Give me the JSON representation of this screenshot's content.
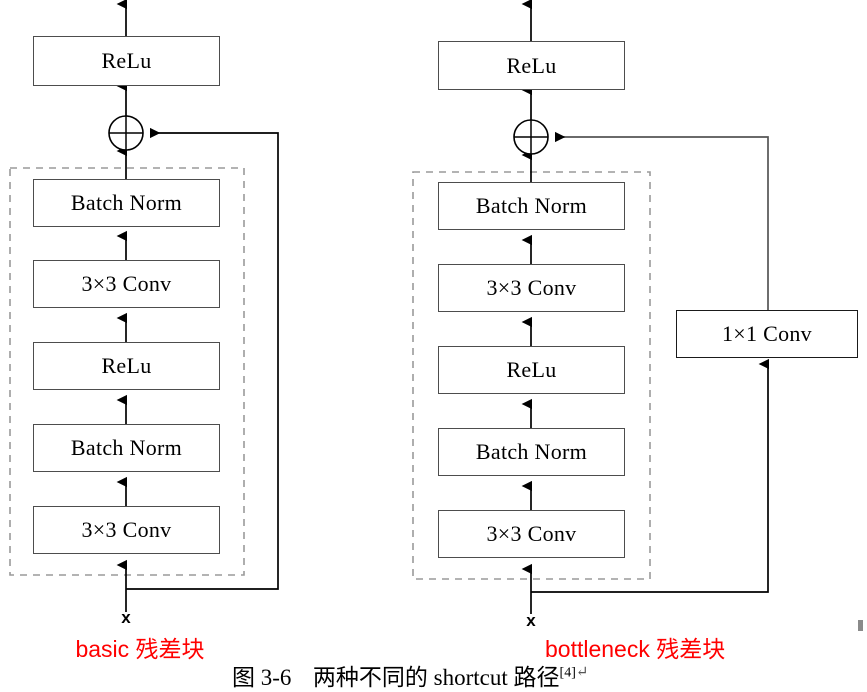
{
  "figure": {
    "caption_prefix": "图 3-6",
    "caption_text": "两种不同的 shortcut 路径",
    "caption_reference": "[4]",
    "caption_mark": "↵",
    "accent_color": "#ff0000",
    "box_border_color": "#4d4d4d",
    "dashed_color": "#9a9a9a",
    "line_color": "#000000"
  },
  "diagrams": [
    {
      "id": "basic-residual-block",
      "label": "basic 残差块",
      "input_label": "x",
      "output_activation": "ReLu",
      "merge_operator": "⊕",
      "main_path": [
        {
          "label": "3×3 Conv"
        },
        {
          "label": "Batch Norm"
        },
        {
          "label": "ReLu"
        },
        {
          "label": "3×3 Conv"
        },
        {
          "label": "Batch Norm"
        }
      ],
      "shortcut_path": []
    },
    {
      "id": "bottleneck-residual-block",
      "label": "bottleneck 残差块",
      "input_label": "x",
      "output_activation": "ReLu",
      "merge_operator": "⊕",
      "main_path": [
        {
          "label": "3×3 Conv"
        },
        {
          "label": "Batch Norm"
        },
        {
          "label": "ReLu"
        },
        {
          "label": "3×3 Conv"
        },
        {
          "label": "Batch Norm"
        }
      ],
      "shortcut_path": [
        {
          "label": "1×1 Conv"
        }
      ]
    }
  ]
}
